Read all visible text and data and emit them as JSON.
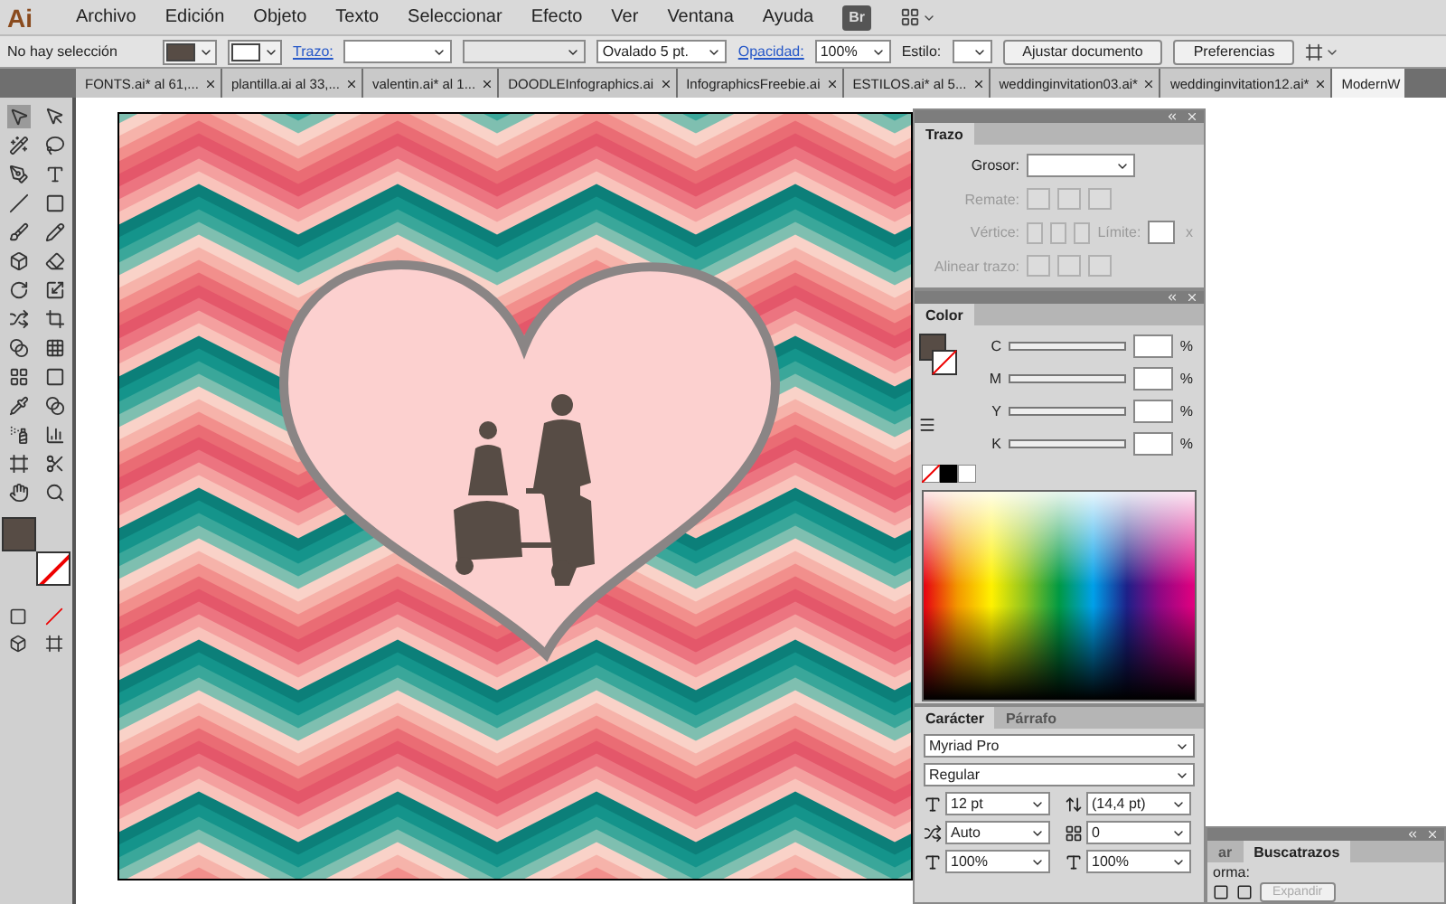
{
  "app_logo": "Ai",
  "menu": [
    "Archivo",
    "Edición",
    "Objeto",
    "Texto",
    "Seleccionar",
    "Efecto",
    "Ver",
    "Ventana",
    "Ayuda"
  ],
  "bridge_button": "Br",
  "control_bar": {
    "selection": "No hay selección",
    "stroke_link": "Trazo:",
    "brush": "Ovalado 5 pt.",
    "opacity_link": "Opacidad:",
    "opacity": "100%",
    "style_label": "Estilo:",
    "buttons": [
      "Ajustar documento",
      "Preferencias"
    ]
  },
  "tabs": [
    {
      "label": "FONTS.ai* al 61,...",
      "selected": false
    },
    {
      "label": "plantilla.ai al 33,...",
      "selected": false
    },
    {
      "label": "valentin.ai* al 1...",
      "selected": false
    },
    {
      "label": "DOODLEInfographics.ai",
      "selected": false
    },
    {
      "label": "InfographicsFreebie.ai",
      "selected": false
    },
    {
      "label": "ESTILOS.ai* al 5...",
      "selected": false
    },
    {
      "label": "weddinginvitation03.ai*",
      "selected": false
    },
    {
      "label": "weddinginvitation12.ai*",
      "selected": false
    },
    {
      "label": "ModernW",
      "selected": true
    }
  ],
  "stroke_panel": {
    "title": "Trazo",
    "weight_label": "Grosor:",
    "rows": [
      {
        "label": "Remate:",
        "disabled": true
      },
      {
        "label": "Vértice:",
        "disabled": true
      },
      {
        "label": "Alinear trazo:",
        "disabled": true
      }
    ],
    "limit_label": "Límite:",
    "limit_unit": "x"
  },
  "color_panel": {
    "title": "Color",
    "channels": [
      {
        "name": "C",
        "unit": "%"
      },
      {
        "name": "M",
        "unit": "%"
      },
      {
        "name": "Y",
        "unit": "%"
      },
      {
        "name": "K",
        "unit": "%"
      }
    ]
  },
  "character_panel": {
    "tabs": [
      {
        "label": "Carácter",
        "selected": true
      },
      {
        "label": "Párrafo",
        "selected": false
      }
    ],
    "font": "Myriad Pro",
    "style": "Regular",
    "fields": [
      {
        "value": "12 pt"
      },
      {
        "value": "(14,4 pt)"
      },
      {
        "value": "Auto"
      },
      {
        "value": "0"
      },
      {
        "value": "100%"
      },
      {
        "value": "100%"
      }
    ]
  },
  "pathfinder_panel": {
    "tabs": [
      {
        "label": "ar",
        "selected": false
      },
      {
        "label": "Buscatrazos",
        "selected": true
      }
    ],
    "label": "orma:",
    "button": {
      "label": "Expandir",
      "disabled": true
    }
  }
}
